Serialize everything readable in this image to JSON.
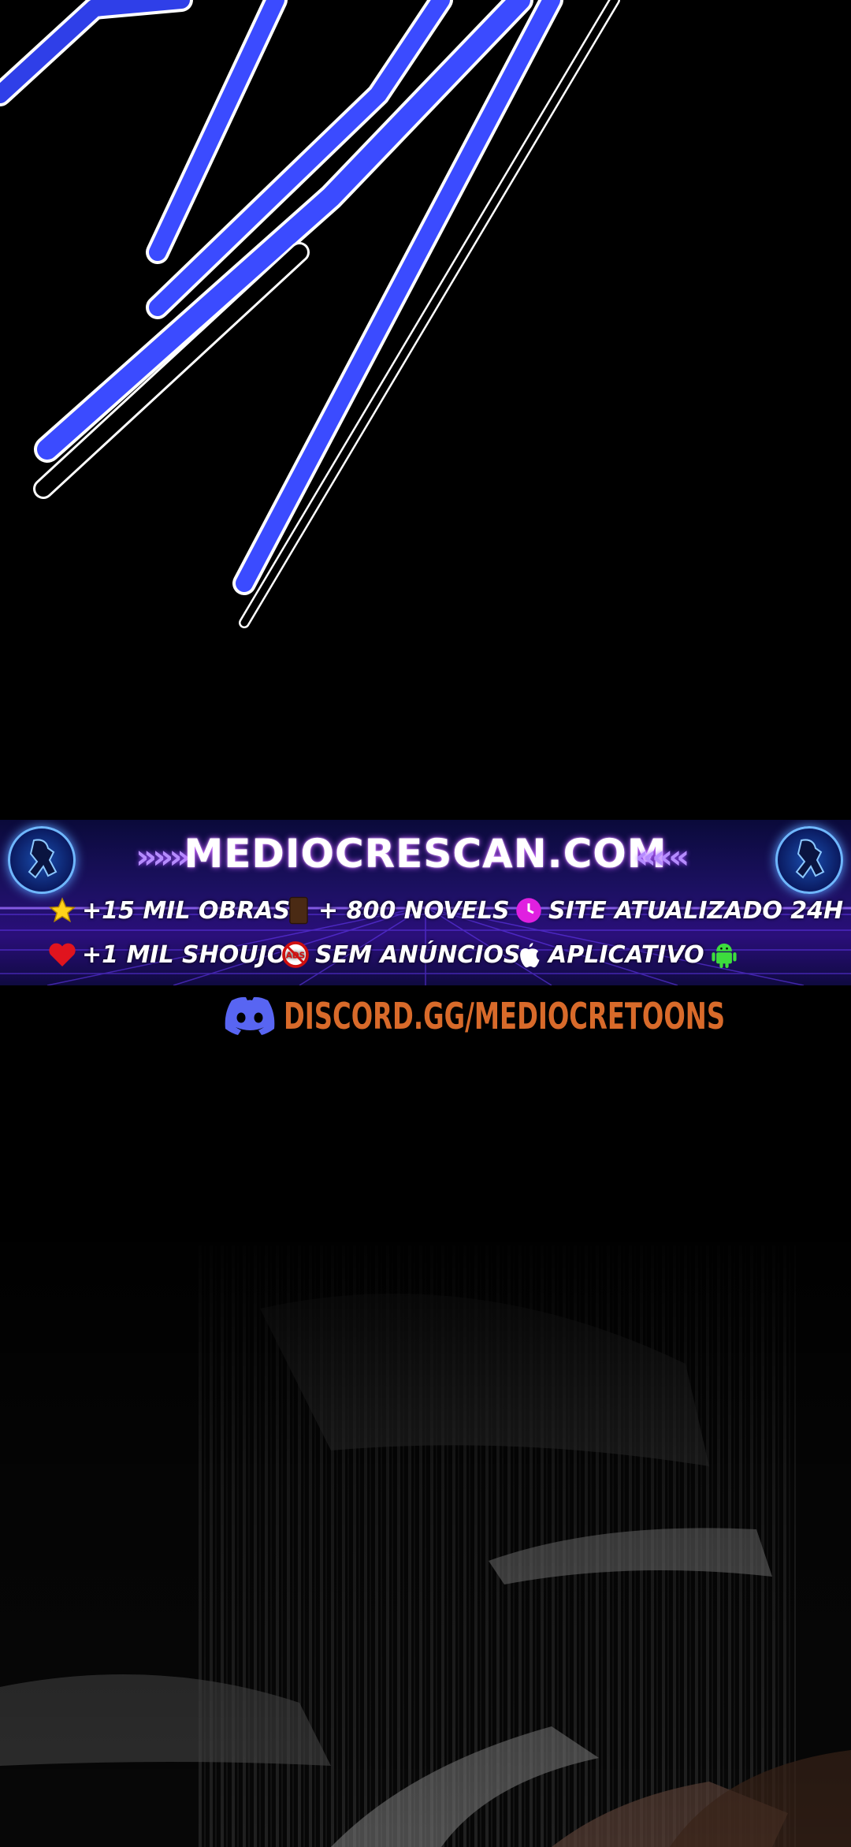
{
  "banner": {
    "site": "MEDIOCRESCAN.COM",
    "arrows_left": "»»»",
    "arrows_right": "«««",
    "features": [
      {
        "icon": "star-icon",
        "label": "+15 MIL OBRAS"
      },
      {
        "icon": "book-icon",
        "label": "+ 800 NOVELS"
      },
      {
        "icon": "clock-icon",
        "label": "SITE ATUALIZADO 24H"
      },
      {
        "icon": "heart-icon",
        "label": "+1 MIL SHOUJO"
      },
      {
        "icon": "no-ads-icon",
        "label": "SEM ANÚNCIOS"
      },
      {
        "icon": "apple-icon",
        "label": "APLICATIVO"
      }
    ]
  },
  "discord": {
    "icon": "discord-icon",
    "text": "DISCORD.GG/MEDIOCRETOONS"
  },
  "colors": {
    "stroke_blue": "#3b4bff",
    "banner_bg": "#1b1060",
    "discord_text": "#d86a2a",
    "discord_logo": "#5865f2"
  }
}
